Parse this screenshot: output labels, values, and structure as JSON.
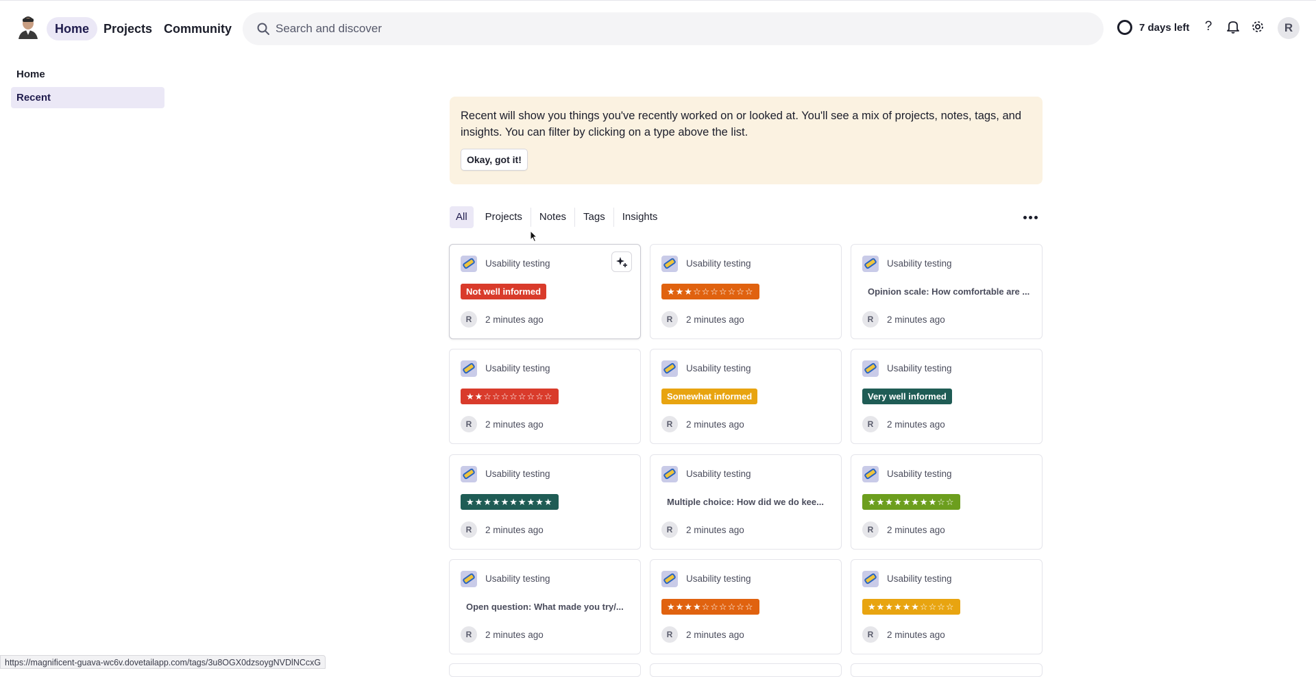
{
  "nav": {
    "home": "Home",
    "projects": "Projects",
    "community": "Community"
  },
  "search": {
    "placeholder": "Search and discover"
  },
  "trial": {
    "label": "7 days left"
  },
  "user": {
    "initial": "R"
  },
  "sidebar": {
    "items": [
      {
        "label": "Home"
      },
      {
        "label": "Recent"
      }
    ]
  },
  "banner": {
    "text": "Recent will show you things you've recently worked on or looked at. You'll see a mix of projects, notes, tags, and insights. You can filter by clicking on a type above the list.",
    "button": "Okay, got it!"
  },
  "filters": [
    "All",
    "Projects",
    "Notes",
    "Tags",
    "Insights"
  ],
  "cards": [
    {
      "project": "Usability testing",
      "kind": "tag",
      "text": "Not well informed",
      "color": "#d93b2b",
      "author": "R",
      "time": "2 minutes ago"
    },
    {
      "project": "Usability testing",
      "kind": "tag",
      "text": "★★★☆☆☆☆☆☆☆",
      "color": "#e0620f",
      "author": "R",
      "time": "2 minutes ago"
    },
    {
      "project": "Usability testing",
      "kind": "question",
      "text": "Opinion scale: How comfortable are ...",
      "author": "R",
      "time": "2 minutes ago"
    },
    {
      "project": "Usability testing",
      "kind": "tag",
      "text": "★★☆☆☆☆☆☆☆☆",
      "color": "#d93b2b",
      "author": "R",
      "time": "2 minutes ago"
    },
    {
      "project": "Usability testing",
      "kind": "tag",
      "text": "Somewhat informed",
      "color": "#e8a410",
      "author": "R",
      "time": "2 minutes ago"
    },
    {
      "project": "Usability testing",
      "kind": "tag",
      "text": "Very well informed",
      "color": "#1f5c55",
      "author": "R",
      "time": "2 minutes ago"
    },
    {
      "project": "Usability testing",
      "kind": "tag",
      "text": "★★★★★★★★★★",
      "color": "#1f5c55",
      "author": "R",
      "time": "2 minutes ago"
    },
    {
      "project": "Usability testing",
      "kind": "question",
      "text": "Multiple choice: How did we do kee...",
      "author": "R",
      "time": "2 minutes ago"
    },
    {
      "project": "Usability testing",
      "kind": "tag",
      "text": "★★★★★★★★☆☆",
      "color": "#6c9e1e",
      "author": "R",
      "time": "2 minutes ago"
    },
    {
      "project": "Usability testing",
      "kind": "question",
      "text": "Open question: What made you try/...",
      "author": "R",
      "time": "2 minutes ago"
    },
    {
      "project": "Usability testing",
      "kind": "tag",
      "text": "★★★★☆☆☆☆☆☆",
      "color": "#e0620f",
      "author": "R",
      "time": "2 minutes ago"
    },
    {
      "project": "Usability testing",
      "kind": "tag",
      "text": "★★★★★★☆☆☆☆",
      "color": "#e8a410",
      "author": "R",
      "time": "2 minutes ago"
    }
  ],
  "status_url": "https://magnificent-guava-wc6v.dovetailapp.com/tags/3u8OGX0dzsoygNVDlNCcxG",
  "icons": {
    "search": "search-icon",
    "help": "help-icon",
    "bell": "bell-icon",
    "settings": "gear-icon",
    "more": "more-horizontal-icon",
    "ai": "sparkle-plus-icon"
  }
}
